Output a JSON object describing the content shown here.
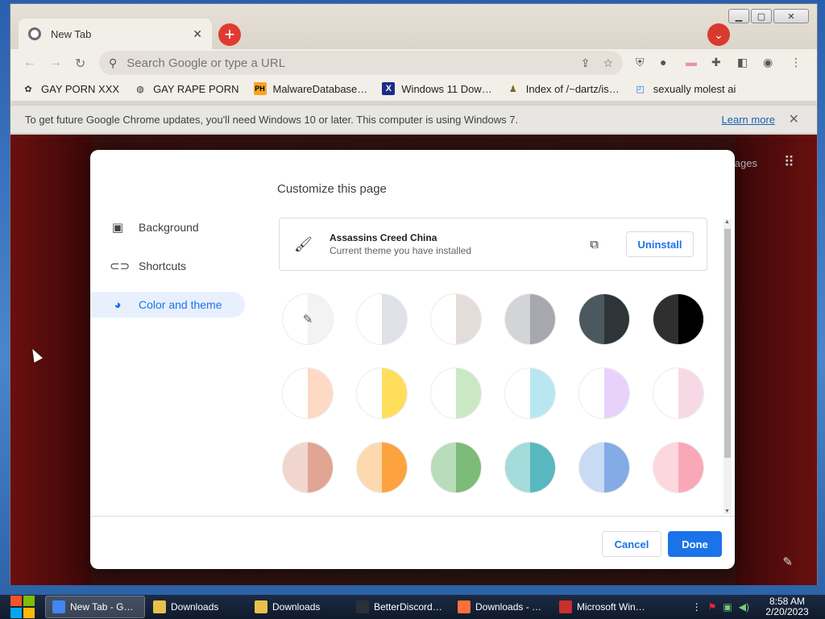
{
  "window": {
    "tab_title": "New Tab",
    "omnibox_placeholder": "Search Google or type a URL"
  },
  "bookmarks": [
    {
      "label": "GAY PORN XXX"
    },
    {
      "label": "GAY RAPE PORN"
    },
    {
      "label": "MalwareDatabase…"
    },
    {
      "label": "Windows 11 Dow…"
    },
    {
      "label": "Index of /~dartz/is…"
    },
    {
      "label": "sexually molest ai"
    }
  ],
  "infobar": {
    "message": "To get future Google Chrome updates, you'll need Windows 10 or later. This computer is using Windows 7.",
    "link": "Learn more"
  },
  "ntp": {
    "partial_text": "ages"
  },
  "dialog": {
    "heading": "Customize this page",
    "sidebar": [
      {
        "label": "Background",
        "icon": "image-icon"
      },
      {
        "label": "Shortcuts",
        "icon": "link-icon"
      },
      {
        "label": "Color and theme",
        "icon": "palette-icon",
        "active": true
      }
    ],
    "theme": {
      "name": "Assassins Creed China",
      "subtitle": "Current theme you have installed",
      "uninstall_label": "Uninstall"
    },
    "swatches": [
      {
        "left": "#ffffff",
        "right": "#f1f3f4",
        "picker": true
      },
      {
        "left": "#ffffff",
        "right": "#dee1e6"
      },
      {
        "left": "#ffffff",
        "right": "#e3dcd8"
      },
      {
        "left": "#d3d4d7",
        "right": "#a6a8ad"
      },
      {
        "left": "#4c5860",
        "right": "#2e3538"
      },
      {
        "left": "#2f2f2f",
        "right": "#000000"
      },
      {
        "left": "#ffffff",
        "right": "#fdd9c6"
      },
      {
        "left": "#ffffff",
        "right": "#fede5b"
      },
      {
        "left": "#ffffff",
        "right": "#cbe8c4"
      },
      {
        "left": "#ffffff",
        "right": "#b9e7f1"
      },
      {
        "left": "#ffffff",
        "right": "#e8d2fc"
      },
      {
        "left": "#ffffff",
        "right": "#f7d9e5"
      },
      {
        "left": "#f1d6cf",
        "right": "#e1a594"
      },
      {
        "left": "#fdd9b0",
        "right": "#fca33f"
      },
      {
        "left": "#b9dcba",
        "right": "#7cbb78"
      },
      {
        "left": "#a3dcda",
        "right": "#58b8bf"
      },
      {
        "left": "#c8daf4",
        "right": "#83abe6"
      },
      {
        "left": "#fdd7de",
        "right": "#faa8b8"
      }
    ],
    "cancel_label": "Cancel",
    "done_label": "Done"
  },
  "taskbar": {
    "items": [
      {
        "label": "New Tab - G…",
        "color": "#4285f4",
        "active": true
      },
      {
        "label": "Downloads",
        "color": "#e8c04a"
      },
      {
        "label": "Downloads",
        "color": "#e8c04a"
      },
      {
        "label": "BetterDiscord…",
        "color": "#2b2f3a"
      },
      {
        "label": "Downloads - …",
        "color": "#ff7139"
      },
      {
        "label": "Microsoft Win…",
        "color": "#c9302c"
      }
    ],
    "time": "8:58 AM",
    "date": "2/20/2023"
  }
}
